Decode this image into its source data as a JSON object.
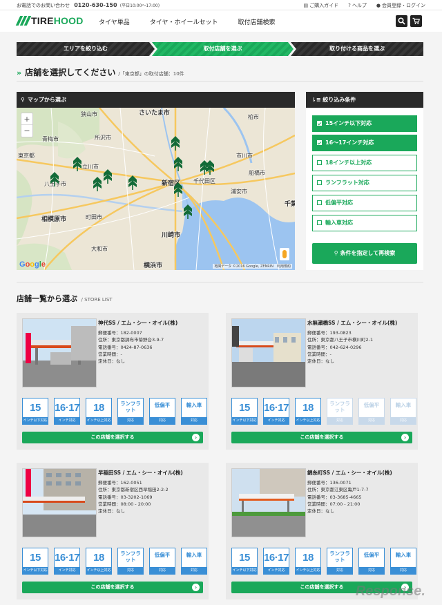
{
  "topbar": {
    "contact_label": "お電話でのお問い合わせ",
    "phone": "0120-630-150",
    "hours": "(平日10:00〜17:00)",
    "guide": "ご購入ガイド",
    "help": "ヘルプ",
    "account": "会員登録・ログイン"
  },
  "header": {
    "logo_a": "TIRE",
    "logo_b": "HOOD",
    "nav": [
      "タイヤ単品",
      "タイヤ・ホイールセット",
      "取付店舗検索"
    ]
  },
  "steps": [
    "エリアを絞り込む",
    "取付店舗を選ぶ",
    "取り付ける商品を選ぶ"
  ],
  "page": {
    "title": "店舗を選択してください",
    "subtitle": "/「東京都」の取付店舗：10件"
  },
  "map": {
    "header": "マップから選ぶ",
    "zoom_in": "+",
    "zoom_out": "−",
    "labels": [
      "さいたま市",
      "狭山市",
      "所沢市",
      "青梅市",
      "東京都",
      "立川市",
      "八王子市",
      "千代田区",
      "新宿区",
      "相模原市",
      "川崎市",
      "横浜市",
      "市川市",
      "船橋市",
      "浦安市",
      "千葉",
      "大和市",
      "町田市",
      "柏市"
    ],
    "attribution": "地図データ ©2016 Google, ZENRIN　利用規約",
    "google": "Google"
  },
  "filter": {
    "header": "絞り込み条件",
    "options": [
      {
        "label": "15インチ以下対応",
        "checked": true
      },
      {
        "label": "16〜17インチ対応",
        "checked": true
      },
      {
        "label": "18インチ以上対応",
        "checked": false
      },
      {
        "label": "ランフラット対応",
        "checked": false
      },
      {
        "label": "低偏平対応",
        "checked": false
      },
      {
        "label": "輸入車対応",
        "checked": false
      }
    ],
    "search_button": "条件を指定して再検索"
  },
  "list": {
    "title": "店舗一覧から選ぶ",
    "title_en": "/ STORE LIST"
  },
  "badge_labels": {
    "b15": "15",
    "b15_foot": "インチ以下対応",
    "b1617": "16·17",
    "b1617_foot": "インチ対応",
    "b18": "18",
    "b18_foot": "インチ以上対応",
    "runflat": "ランフラット",
    "runflat_foot": "対応",
    "lowprofile": "低偏平",
    "lowprofile_foot": "対応",
    "import": "輸入車",
    "import_foot": "対応"
  },
  "stores": [
    {
      "name": "神代SS / エム・シー・オイル(株)",
      "postal": "郵便番号：182-0007",
      "address": "住所：東京都調布市菊野台3-9-7",
      "phone": "電話番号：0424-87-0636",
      "hours": "営業時間：-",
      "closed": "定休日：なし",
      "badges_on": [
        true,
        true,
        true,
        true,
        true,
        true
      ],
      "select": "この店舗を選択する"
    },
    {
      "name": "水無瀬橋SS / エム・シー・オイル(株)",
      "postal": "郵便番号：193-0823",
      "address": "住所：東京都八王子市横川町2-1",
      "phone": "電話番号：042-624-0296",
      "hours": "営業時間：-",
      "closed": "定休日：なし",
      "badges_on": [
        true,
        true,
        true,
        false,
        false,
        false
      ],
      "select": "この店舗を選択する"
    },
    {
      "name": "早稲田SS / エム・シー・オイル(株)",
      "postal": "郵便番号：162-0051",
      "address": "住所：東京都新宿区西早稲田2-2-2",
      "phone": "電話番号：03-3202-1069",
      "hours": "営業時間：08:00 - 20:00",
      "closed": "定休日：なし",
      "badges_on": [
        true,
        true,
        true,
        true,
        true,
        true
      ],
      "select": "この店舗を選択する"
    },
    {
      "name": "錦糸町SS / エム・シー・オイル(株)",
      "postal": "郵便番号：136-0071",
      "address": "住所：東京都江東区亀戸1-7-7",
      "phone": "電話番号：03-3685-4665",
      "hours": "営業時間：07:00 - 21:00",
      "closed": "定休日：なし",
      "badges_on": [
        true,
        true,
        true,
        true,
        true,
        true
      ],
      "select": "この店舗を選択する"
    }
  ],
  "watermark": "Response.",
  "colors": {
    "brand_green": "#1aa85a",
    "badge_blue": "#3a8fd6",
    "dark_bar": "#2a2a2a"
  }
}
